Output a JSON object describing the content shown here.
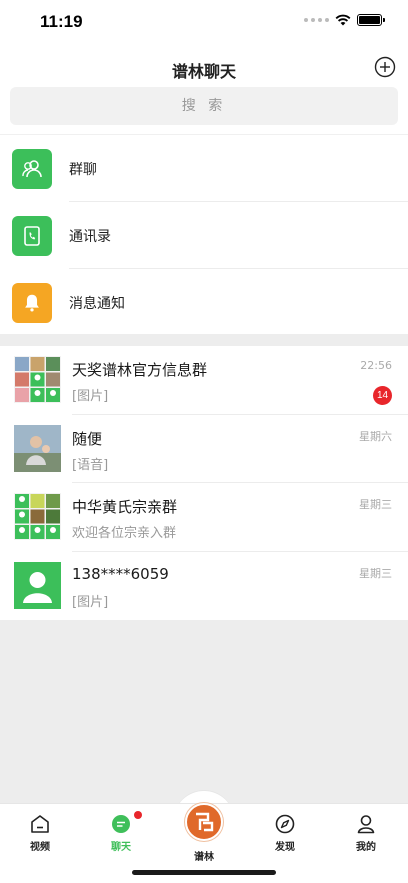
{
  "status_bar": {
    "time": "11:19"
  },
  "nav": {
    "title": "谱林聊天",
    "search_placeholder": "搜 索"
  },
  "functions": [
    {
      "label": "群聊",
      "color": "#3cbf5a",
      "icon": "group-icon"
    },
    {
      "label": "通讯录",
      "color": "#3cbf5a",
      "icon": "contacts-icon"
    },
    {
      "label": "消息通知",
      "color": "#f5a623",
      "icon": "bell-icon"
    }
  ],
  "chats": [
    {
      "name": "天奖谱林官方信息群",
      "message": "[图片]",
      "time": "22:56",
      "badge": "14"
    },
    {
      "name": "随便",
      "message": "[语音]",
      "time": "星期六"
    },
    {
      "name": "中华黄氏宗亲群",
      "message": "欢迎各位宗亲入群",
      "time": "星期三"
    },
    {
      "name": "138****6059",
      "message": "[图片]",
      "time": "星期三"
    }
  ],
  "tabs": [
    {
      "label": "视频",
      "icon": "home-icon"
    },
    {
      "label": "聊天",
      "icon": "chat-icon",
      "active": true
    },
    {
      "label": "谱林",
      "icon": "pulin-logo-icon"
    },
    {
      "label": "发现",
      "icon": "compass-icon"
    },
    {
      "label": "我的",
      "icon": "person-icon"
    }
  ],
  "colors": {
    "accent": "#3fbf5a",
    "badge": "#e8262b",
    "center_tab": "#e0692a"
  }
}
